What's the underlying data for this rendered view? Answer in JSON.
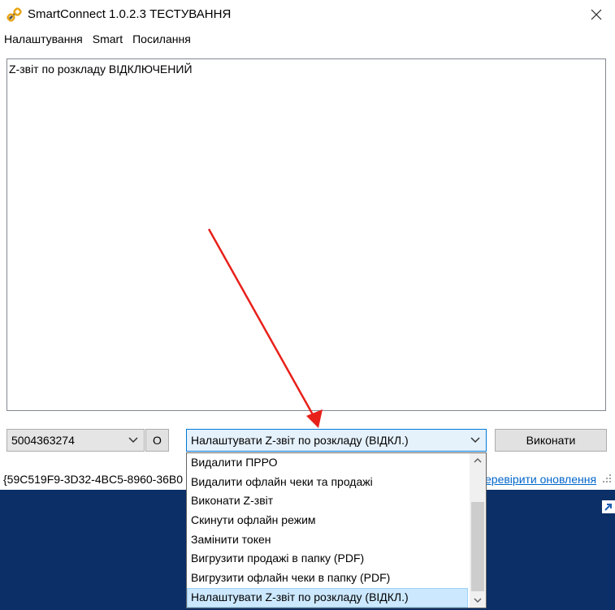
{
  "window": {
    "title": "SmartConnect 1.0.2.3 ТЕСТУВАННЯ"
  },
  "menu": {
    "items": [
      {
        "label": "Налаштування"
      },
      {
        "label": "Smart"
      },
      {
        "label": "Посилання"
      }
    ]
  },
  "log": {
    "text": "Z-звіт по розкладу ВІДКЛЮЧЕНИЙ"
  },
  "controls": {
    "device_select_value": "5004363274",
    "o_button_label": "О",
    "action_select_value": "Налаштувати Z-звіт по розкладу (ВІДКЛ.)",
    "execute_button_label": "Виконати"
  },
  "status": {
    "guid_text": "{59C519F9-3D32-4BC5-8960-36B0",
    "update_link": "еревірити оновлення"
  },
  "dropdown": {
    "options": [
      {
        "label": "Видалити ПРРО"
      },
      {
        "label": "Видалити офлайн чеки та продажі"
      },
      {
        "label": "Виконати Z-звіт"
      },
      {
        "label": "Скинути офлайн режим"
      },
      {
        "label": "Замінити токен"
      },
      {
        "label": "Вигрузити продажі в папку (PDF)"
      },
      {
        "label": "Вигрузити офлайн чеки в папку (PDF)"
      },
      {
        "label": "Налаштувати Z-звіт по розкладу (ВІДКЛ.)"
      }
    ],
    "selected_index": 7
  },
  "colors": {
    "selection": "#cce8ff",
    "link": "#0066cc",
    "annotation_arrow": "#e8201a",
    "desktop": "#0b2f66"
  },
  "icons": {
    "app": "chain-link-icon",
    "close": "close-icon",
    "dropdown": "chevron-down-icon"
  }
}
